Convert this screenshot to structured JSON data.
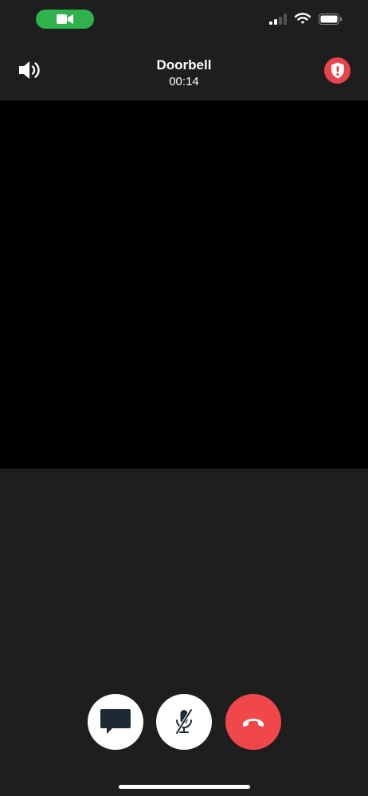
{
  "status_bar": {
    "call_pill_icon": "video-camera-icon",
    "call_pill_color": "#2fb24c",
    "signal_icon": "cellular-signal-icon",
    "wifi_icon": "wifi-icon",
    "battery_icon": "battery-icon"
  },
  "header": {
    "caller_name": "Doorbell",
    "timer": "00:14",
    "speaker_icon": "speaker-volume-icon",
    "alert_icon": "shield-alert-icon",
    "alert_color": "#e8444a"
  },
  "controls": {
    "chat_icon": "chat-bubble-icon",
    "mute_icon": "microphone-muted-icon",
    "end_call_icon": "phone-hangup-icon",
    "end_call_color": "#f0474a"
  }
}
